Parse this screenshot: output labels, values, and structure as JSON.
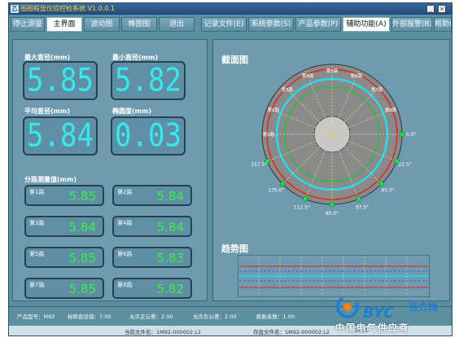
{
  "window": {
    "title": "图图程显仪综控检系统 V1.0.0.1"
  },
  "menu": {
    "items": [
      {
        "label": "停止测量"
      },
      {
        "label": "主界面"
      },
      {
        "label": "波动图"
      },
      {
        "label": "棒图图"
      },
      {
        "label": "退出"
      },
      {
        "label": "记录文件(E)"
      },
      {
        "label": "系统参数(S)"
      },
      {
        "label": "产品参数(P)"
      },
      {
        "label": "辅助功能(A)"
      },
      {
        "label": "外部报警(B)"
      },
      {
        "label": "帮助(H)"
      }
    ]
  },
  "left": {
    "max_label": "最大直径(mm)",
    "max_value": "5.85",
    "min_label": "最小直径(mm)",
    "min_value": "5.82",
    "avg_label": "平均直径(mm)",
    "avg_value": "5.84",
    "ovality_label": "椭圆度(mm)",
    "ovality_value": "0.03",
    "segments_label": "分路测量值(mm)",
    "segments": [
      {
        "name": "第1路",
        "value": "5.85"
      },
      {
        "name": "第2路",
        "value": "5.84"
      },
      {
        "name": "第3路",
        "value": "5.84"
      },
      {
        "name": "第4路",
        "value": "5.84"
      },
      {
        "name": "第5路",
        "value": "5.85"
      },
      {
        "name": "第6路",
        "value": "5.83"
      },
      {
        "name": "第7路",
        "value": "5.85"
      },
      {
        "name": "第8路",
        "value": "5.82"
      }
    ]
  },
  "right": {
    "section_title": "截面图",
    "trend_title": "趋势图",
    "angle_labels": [
      "0.0°",
      "22.5°",
      "45.0°",
      "67.5°",
      "90.0°",
      "112.5°",
      "135.0°",
      "157.5°"
    ],
    "outer_labels": [
      "第1路",
      "第2路",
      "第3路",
      "第4路",
      "第5路",
      "第6路",
      "第7路",
      "第8路"
    ]
  },
  "status": {
    "product_model": "产品型号：M92",
    "std_diameter": "标称直径值：7.00",
    "pos_tol": "允许正公差：2.00",
    "neg_tol": "允许负公差：2.00",
    "expansion": "膨胀系数：1.00"
  },
  "bottom": {
    "current_file": "当前文件名：1M92-000002.L2",
    "save_file": "存盘文件名：1M92-000002.L2",
    "date": "2011-"
  },
  "watermark": {
    "logo": "BYC",
    "cn": "百方网",
    "sub": "中国电气供应商"
  },
  "colors": {
    "panel": "#6e9bb0",
    "value_cyan": "#38e8f0",
    "segment_green": "#39f046"
  }
}
